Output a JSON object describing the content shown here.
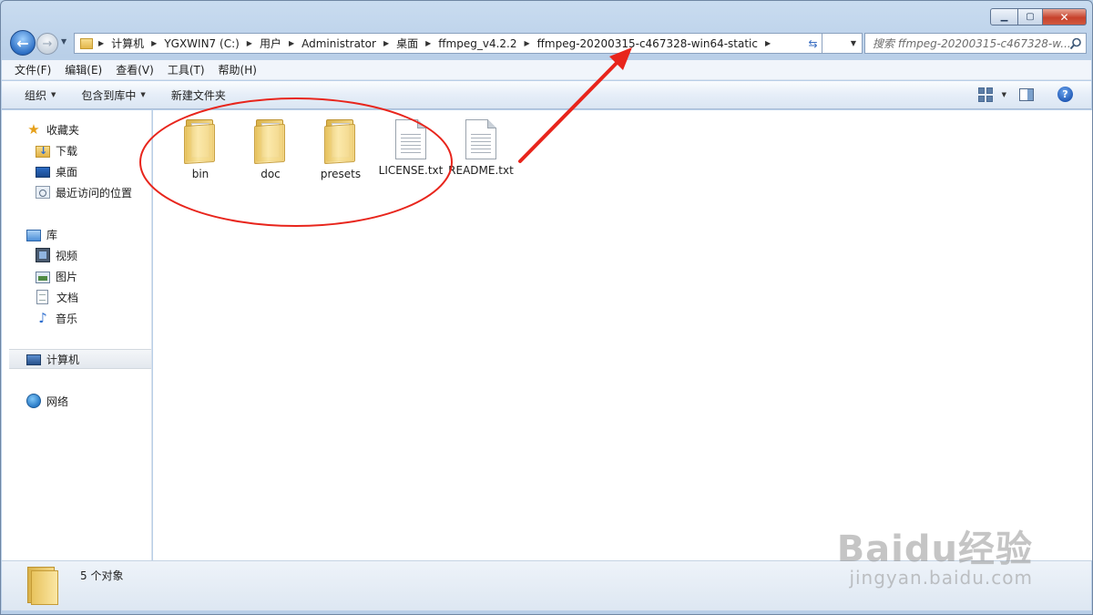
{
  "address": {
    "crumbs": [
      "计算机",
      "YGXWIN7 (C:)",
      "用户",
      "Administrator",
      "桌面",
      "ffmpeg_v4.2.2",
      "ffmpeg-20200315-c467328-win64-static"
    ]
  },
  "search": {
    "placeholder": "搜索 ffmpeg-20200315-c467328-w..."
  },
  "menu": {
    "items": [
      "文件(F)",
      "编辑(E)",
      "查看(V)",
      "工具(T)",
      "帮助(H)"
    ]
  },
  "toolbar": {
    "organize": "组织",
    "include_library": "包含到库中",
    "new_folder": "新建文件夹"
  },
  "sidebar": {
    "favorites": {
      "label": "收藏夹",
      "items": [
        "下载",
        "桌面",
        "最近访问的位置"
      ]
    },
    "libraries": {
      "label": "库",
      "items": [
        "视频",
        "图片",
        "文档",
        "音乐"
      ]
    },
    "computer": "计算机",
    "network": "网络"
  },
  "files": [
    {
      "name": "bin",
      "type": "folder"
    },
    {
      "name": "doc",
      "type": "folder"
    },
    {
      "name": "presets",
      "type": "folder"
    },
    {
      "name": "LICENSE.txt",
      "type": "text"
    },
    {
      "name": "README.txt",
      "type": "text"
    }
  ],
  "status": {
    "count_text": "5 个对象"
  },
  "watermark": {
    "main": "Baidu经验",
    "sub": "jingyan.baidu.com"
  },
  "colors": {
    "annotation": "#e8251c",
    "window_frame": "#b9cfe8",
    "selection": "#e3e8ee"
  }
}
